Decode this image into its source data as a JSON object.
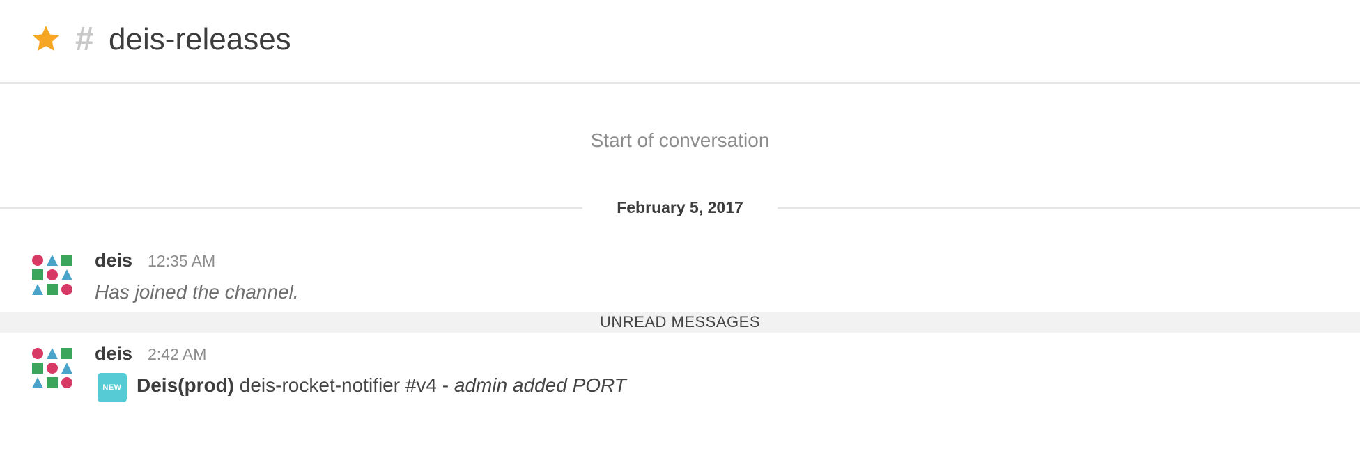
{
  "header": {
    "channel_prefix": "#",
    "channel_name": "deis-releases",
    "star_icon": "star-icon",
    "star_color": "#f5a623"
  },
  "conversation": {
    "start_label": "Start of conversation",
    "date_divider": "February 5, 2017",
    "unread_label": "UNREAD MESSAGES"
  },
  "messages": [
    {
      "username": "deis",
      "time": "12:35 AM",
      "text": "Has joined the channel."
    },
    {
      "username": "deis",
      "time": "2:42 AM",
      "badge": "NEW",
      "app_name": "Deis(prod)",
      "text_mid": " deis-rocket-notifier #v4 - ",
      "text_italic": "admin added PORT"
    }
  ],
  "colors": {
    "avatar_pink": "#d63964",
    "avatar_blue": "#4aa3c9",
    "avatar_green": "#3ba55c",
    "badge": "#56cbd6"
  }
}
